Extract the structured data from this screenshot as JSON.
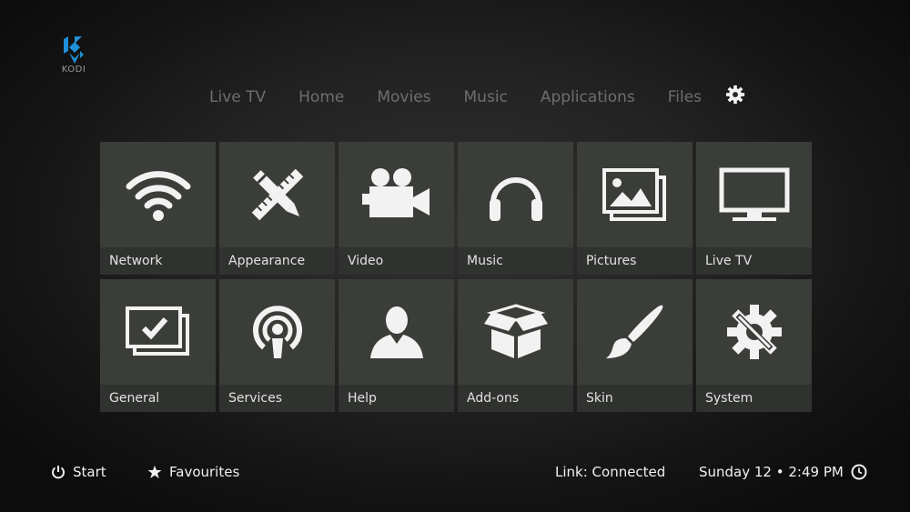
{
  "logo": {
    "text": "KODI"
  },
  "nav": {
    "items": [
      {
        "label": "Live TV"
      },
      {
        "label": "Home"
      },
      {
        "label": "Movies"
      },
      {
        "label": "Music"
      },
      {
        "label": "Applications"
      },
      {
        "label": "Files"
      }
    ],
    "settings_icon": "gear-icon"
  },
  "tiles": [
    {
      "label": "Network",
      "icon": "wifi-icon"
    },
    {
      "label": "Appearance",
      "icon": "pencil-ruler-icon"
    },
    {
      "label": "Video",
      "icon": "video-camera-icon"
    },
    {
      "label": "Music",
      "icon": "headphones-icon"
    },
    {
      "label": "Pictures",
      "icon": "pictures-icon"
    },
    {
      "label": "Live TV",
      "icon": "tv-icon"
    },
    {
      "label": "General",
      "icon": "general-check-icon"
    },
    {
      "label": "Services",
      "icon": "podcast-icon"
    },
    {
      "label": "Help",
      "icon": "person-icon"
    },
    {
      "label": "Add-ons",
      "icon": "open-box-icon"
    },
    {
      "label": "Skin",
      "icon": "paintbrush-icon"
    },
    {
      "label": "System",
      "icon": "gear-wrench-icon"
    }
  ],
  "bottom": {
    "start_label": "Start",
    "favourites_label": "Favourites",
    "link_status": "Link: Connected",
    "datetime": "Sunday 12 • 2:49 PM"
  },
  "colors": {
    "tile_bg": "#3a3d38",
    "tile_label_bg": "#2f322e",
    "nav_text": "#6e6e6e",
    "accent_logo": "#1f8fd8"
  }
}
